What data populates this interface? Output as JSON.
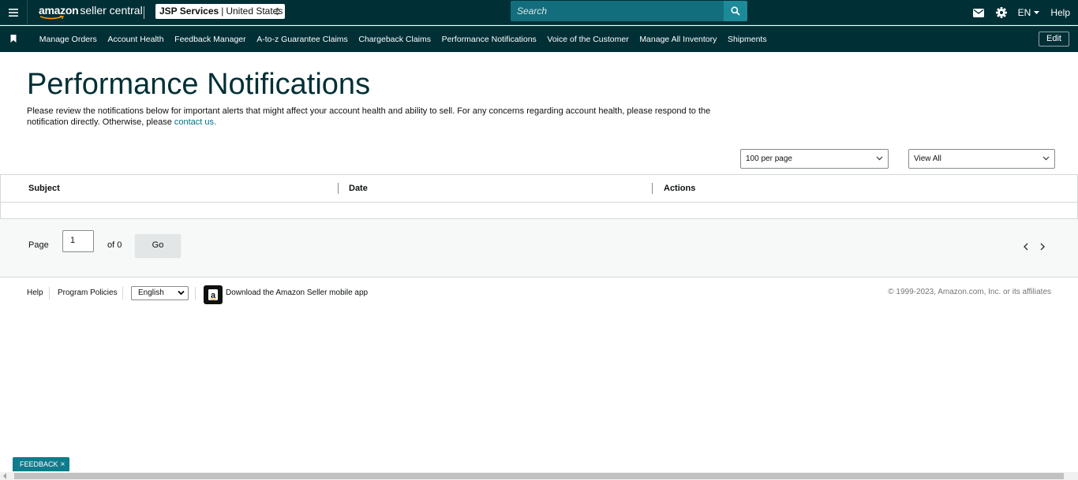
{
  "topbar": {
    "menu_icon": "hamburger-menu-icon",
    "logo_brand": "amazon",
    "logo_suffix": "seller central",
    "account_name": "JSP Services",
    "account_divider": "|",
    "account_region": "United States",
    "search_placeholder": "Search",
    "language": "EN",
    "help": "Help"
  },
  "nav": {
    "items": [
      "Manage Orders",
      "Account Health",
      "Feedback Manager",
      "A-to-z Guarantee Claims",
      "Chargeback Claims",
      "Performance Notifications",
      "Voice of the Customer",
      "Manage All Inventory",
      "Shipments"
    ],
    "edit": "Edit"
  },
  "page": {
    "title": "Performance Notifications",
    "description": "Please review the notifications below for important alerts that might affect your account health and ability to sell. For any concerns regarding account health, please respond to the notification directly. Otherwise, please",
    "contact_link": "contact us."
  },
  "controls": {
    "per_page": "100 per page",
    "filter": "View All"
  },
  "table": {
    "columns": [
      "Subject",
      "Date",
      "Actions"
    ]
  },
  "pager": {
    "page_label": "Page",
    "page_value": "1",
    "of_label": "of 0",
    "go": "Go"
  },
  "footer": {
    "help": "Help",
    "policies": "Program Policies",
    "language": "English",
    "app_text": "Download the Amazon Seller mobile app",
    "copyright": "© 1999-2023, Amazon.com, Inc. or its affiliates"
  },
  "feedback": {
    "label": "FEEDBACK",
    "close": "×"
  },
  "colors": {
    "header_bg": "#002f36",
    "search_bg": "#126e7c",
    "accent": "#007185",
    "feedback_bg": "#0e7c8c"
  }
}
